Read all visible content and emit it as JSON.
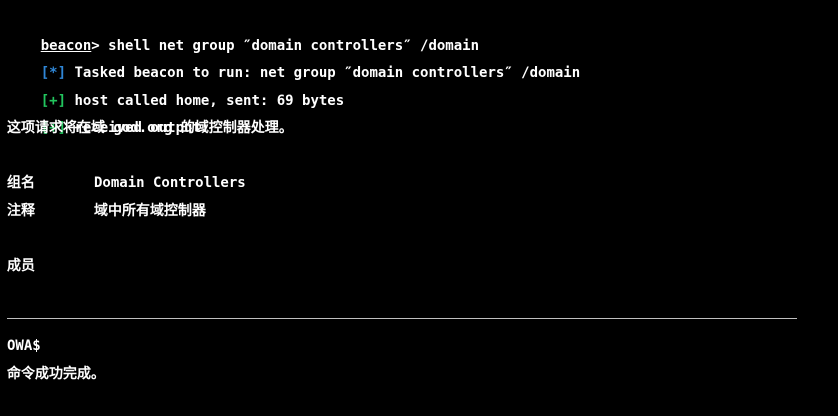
{
  "terminal": {
    "colors": {
      "background": "#000000",
      "text": "#ffffff",
      "info_tag": "#2f86d6",
      "success_tag": "#22c55e",
      "divider": "#bfbfbf"
    },
    "prompt": {
      "name": "beacon",
      "arrow": ">",
      "command": " shell net group ″domain controllers″ /domain"
    },
    "lines": [
      {
        "tag": "[*]",
        "text": " Tasked beacon to run: net group ″domain controllers″ /domain"
      },
      {
        "tag": "[+]",
        "text": " host called home, sent: 69 bytes"
      },
      {
        "tag": "[+]",
        "text": " received output:"
      }
    ],
    "output": {
      "intro": "这项请求将在域 god.org 的域控制器处理。",
      "group_label": "组名",
      "group_value": "Domain Controllers",
      "comment_label": "注释",
      "comment_value": "域中所有域控制器",
      "members_label": "成员",
      "member_name": "OWA$",
      "result": "命令成功完成。"
    }
  }
}
